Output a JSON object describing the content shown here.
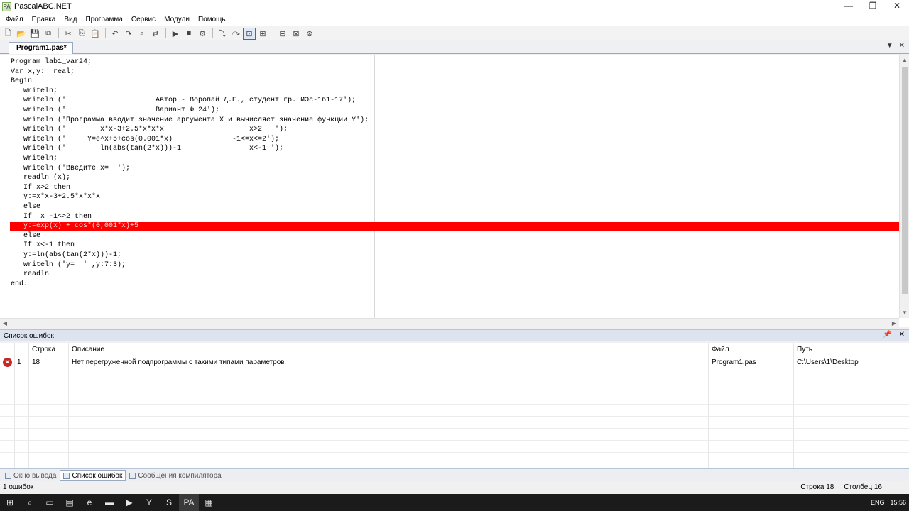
{
  "window": {
    "title": "PascalABC.NET",
    "app_icon": "PA"
  },
  "window_controls": {
    "minimize": "—",
    "maximize": "❐",
    "close": "✕"
  },
  "menu": [
    "Файл",
    "Правка",
    "Вид",
    "Программа",
    "Сервис",
    "Модули",
    "Помощь"
  ],
  "toolbar": {
    "icons": [
      "new-file-icon",
      "open-file-icon",
      "save-icon",
      "save-all-icon",
      "cut-icon",
      "copy-icon",
      "paste-icon",
      "undo-icon",
      "redo-icon",
      "find-icon",
      "replace-icon",
      "run-icon",
      "stop-icon",
      "compile-icon",
      "step-into-icon",
      "step-over-icon",
      "console-icon",
      "debug-icon",
      "build-icon",
      "rebuild-icon",
      "module-icon"
    ],
    "glyphs": [
      "🗋",
      "📂",
      "💾",
      "⧉",
      "✂",
      "⎘",
      "📋",
      "↶",
      "↷",
      "⌕",
      "⇄",
      "▶",
      "■",
      "⚙",
      "⤵",
      "⤼",
      "⊡",
      "⊞",
      "⊟",
      "⊠",
      "⊛"
    ]
  },
  "editor": {
    "tab_label": "Program1.pas*",
    "lines": [
      "Program lab1_var24;",
      "Var x,y:  real;",
      "Begin",
      "   writeln;",
      "   writeln ('                     Автор - Воропай Д.Е., студент гр. ИЭс-161-17');",
      "   writeln ('                     Вариант № 24');",
      "   writeln ('Программа вводит значение аргумента X и вычисляет значение функции Y');",
      "   writeln ('        x*x-3+2.5*x*x*x                    x>2   ');",
      "   writeln ('     Y=e^x+5+cos(0.001*x)              -1<=x<=2');",
      "   writeln ('        ln(abs(tan(2*x)))-1                x<-1 ');",
      "   writeln;",
      "   writeln ('Введите x=  ');",
      "   readln (x);",
      "   If x>2 then",
      "   y:=x*x-3+2.5*x*x*x",
      "   else",
      "   If  x -1<>2 then",
      "   y:=exp(x) + cos*(0,001*x)+5",
      "   else",
      "   If x<-1 then",
      "   y:=ln(abs(tan(2*x)))-1;",
      "   writeln ('y=  ' ,y:7:3);",
      "   readln",
      "end."
    ],
    "error_line_index": 17
  },
  "error_panel": {
    "title": "Список ошибок",
    "columns": [
      "Строка",
      "Описание",
      "Файл",
      "Путь"
    ],
    "rows": [
      {
        "num": "1",
        "line": "18",
        "description": "Нет перегруженной подпрограммы с такими типами параметров",
        "file": "Program1.pas",
        "path": "C:\\Users\\1\\Desktop"
      }
    ]
  },
  "bottom_tabs": [
    "Окно вывода",
    "Список ошибок",
    "Сообщения компилятора"
  ],
  "status": {
    "errors": "1 ошибок",
    "line_label": "Строка",
    "line_value": "18",
    "col_label": "Столбец",
    "col_value": "16"
  },
  "taskbar": {
    "icons": [
      "windows-start-icon",
      "search-icon",
      "task-view-icon",
      "explorer-icon",
      "edge-icon",
      "folder-icon",
      "media-icon",
      "yandex-icon",
      "skype-icon",
      "pascal-icon",
      "calculator-icon"
    ],
    "glyphs": [
      "⊞",
      "⌕",
      "▭",
      "▤",
      "e",
      "▬",
      "▶",
      "Y",
      "S",
      "PA",
      "▦"
    ],
    "lang": "ENG",
    "time": "15:56"
  }
}
